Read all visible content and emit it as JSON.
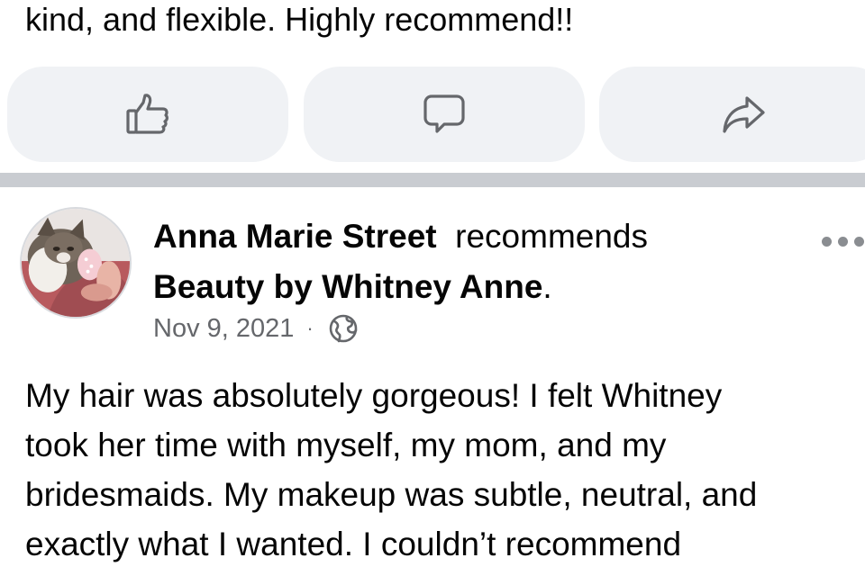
{
  "previous_post": {
    "text_tail": "kind, and flexible. Highly recommend!!",
    "actions": [
      {
        "name": "like",
        "icon": "thumbs-up-icon"
      },
      {
        "name": "comment",
        "icon": "comment-bubble-icon"
      },
      {
        "name": "share",
        "icon": "share-arrow-icon"
      }
    ]
  },
  "post": {
    "author": "Anna Marie Street",
    "verb": "recommends",
    "page_name": "Beauty by Whitney Anne",
    "page_suffix": ".",
    "date": "Nov 9, 2021",
    "separator": "·",
    "audience_icon": "globe-icon",
    "more_icon": "more-options-icon",
    "body_lines": [
      "My hair was absolutely gorgeous! I felt Whitney",
      "took her time with myself, my mom, and my",
      "bridesmaids. My makeup was subtle, neutral, and",
      "exactly what I wanted. I couldn’t recommend"
    ]
  },
  "colors": {
    "background": "#ffffff",
    "button_bg": "#f0f2f5",
    "divider": "#c9ccd1",
    "secondary_text": "#65676b",
    "icon": "#65676b"
  }
}
